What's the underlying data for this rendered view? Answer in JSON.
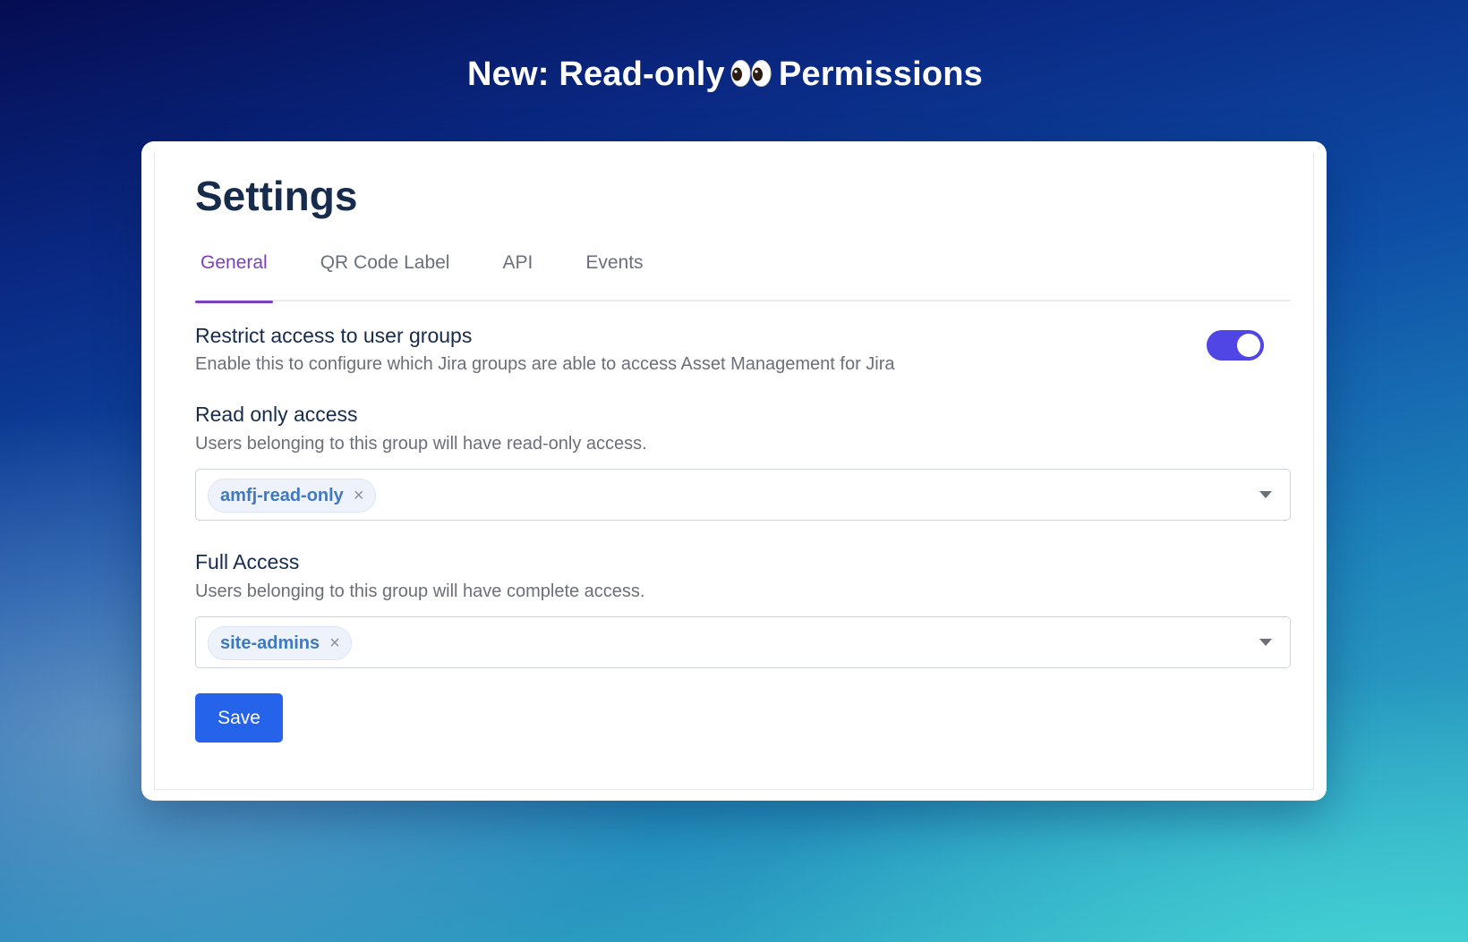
{
  "headline": {
    "before": "New: Read-only",
    "after": "Permissions",
    "emoji_icon": "eyes-icon"
  },
  "settings": {
    "title": "Settings",
    "tabs": [
      {
        "label": "General",
        "active": true
      },
      {
        "label": "QR Code Label",
        "active": false
      },
      {
        "label": "API",
        "active": false
      },
      {
        "label": "Events",
        "active": false
      }
    ],
    "restrict": {
      "title": "Restrict access to user groups",
      "description": "Enable this to configure which Jira groups are able to access Asset Management for Jira",
      "enabled": true
    },
    "read_only": {
      "title": "Read only access",
      "description": "Users belonging to this group will have read-only access.",
      "groups": [
        "amfj-read-only"
      ]
    },
    "full_access": {
      "title": "Full Access",
      "description": "Users belonging to this group will have complete access.",
      "groups": [
        "site-admins"
      ]
    },
    "chip_remove_symbol": "×",
    "save_label": "Save"
  },
  "colors": {
    "accent_tab": "#7b3fbf",
    "toggle": "#4f46e5",
    "save_button": "#2563eb",
    "chip_text": "#3f7ac0"
  }
}
